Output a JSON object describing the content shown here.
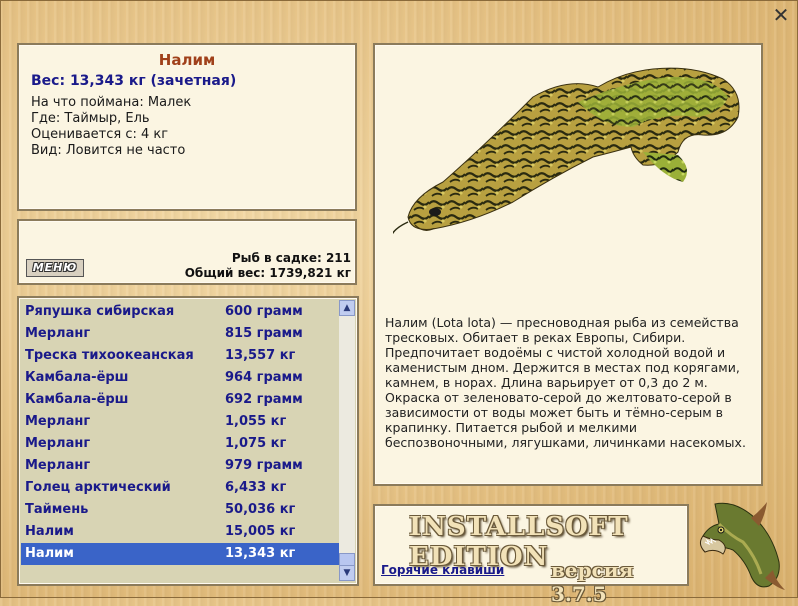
{
  "window": {
    "close_label": "✕"
  },
  "info": {
    "title": "Налим",
    "weight": "Вес: 13,343 кг (зачетная)",
    "lines": [
      "На что поймана: Малек",
      "Где: Таймыр, Ель",
      "Оценивается с: 4 кг",
      "Вид: Ловится не часто"
    ]
  },
  "menu": {
    "label": "МЕНЮ"
  },
  "stats": {
    "count": "Рыб в садке: 211",
    "total_weight": "Общий вес: 1739,821 кг"
  },
  "list": [
    {
      "name": "Ряпушка сибирская",
      "weight": "600 грамм"
    },
    {
      "name": "Мерланг",
      "weight": "815 грамм"
    },
    {
      "name": "Треска тихоокеанская",
      "weight": "13,557 кг"
    },
    {
      "name": "Камбала-ёрш",
      "weight": "964 грамм"
    },
    {
      "name": "Камбала-ёрш",
      "weight": "692 грамм"
    },
    {
      "name": "Мерланг",
      "weight": "1,055 кг"
    },
    {
      "name": "Мерланг",
      "weight": "1,075 кг"
    },
    {
      "name": "Мерланг",
      "weight": "979 грамм"
    },
    {
      "name": "Голец арктический",
      "weight": "6,433 кг"
    },
    {
      "name": "Таймень",
      "weight": "50,036 кг"
    },
    {
      "name": "Налим",
      "weight": "15,005 кг"
    },
    {
      "name": "Налим",
      "weight": "13,343 кг",
      "selected": true
    }
  ],
  "scrollbar": {
    "up_icon": "chevron-up-icon",
    "down_icon": "chevron-down-icon"
  },
  "fish": {
    "description": "Налим (Lota lota) — пресноводная рыба из семейства тресковых. Обитает в реках Европы, Сибири. Предпочитает водоёмы с чистой холодной водой и каменистым дном. Держится в местах под корягами, камнем, в норах. Длина варьирует от 0,3 до 2 м. Окраска от зеленовато-серой до желтовато-серой в зависимости от воды может быть и тёмно-серым в крапинку. Питается рыбой и мелкими беспозвоночными, лягушками, личинками насекомых."
  },
  "brand": {
    "title": "INSTALLSOFT EDITION",
    "hotkeys": "Горячие клавиши",
    "version": "версия 3.7.5"
  },
  "colors": {
    "selection": "#3a64c8",
    "list_text": "#1a1a8a",
    "title": "#a0401a"
  }
}
